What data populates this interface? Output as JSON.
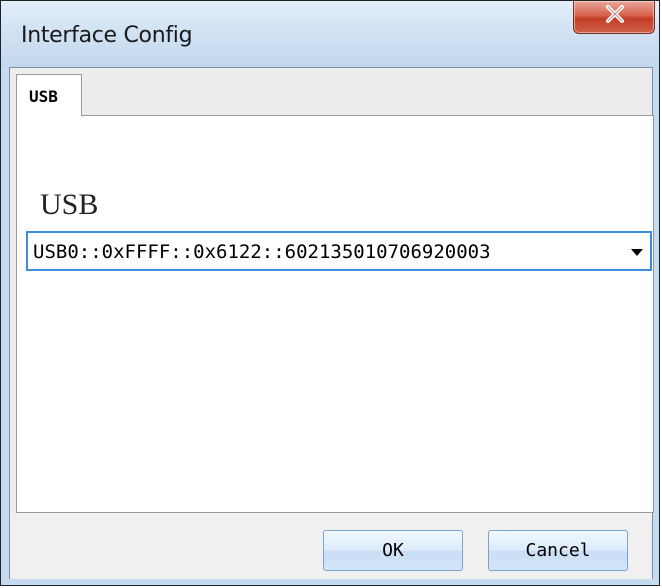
{
  "window": {
    "title": "Interface Config",
    "close_icon": "close-icon"
  },
  "tabs": [
    {
      "label": "USB",
      "selected": true
    }
  ],
  "usb_panel": {
    "label": "USB",
    "combo_value": "USB0::0xFFFF::0x6122::602135010706920003",
    "dropdown_icon": "chevron-down-icon"
  },
  "buttons": {
    "ok": "OK",
    "cancel": "Cancel"
  },
  "colors": {
    "accent_border": "#3d8ee0",
    "close_button": "#c23d27",
    "frame": "#c7dbf0"
  }
}
